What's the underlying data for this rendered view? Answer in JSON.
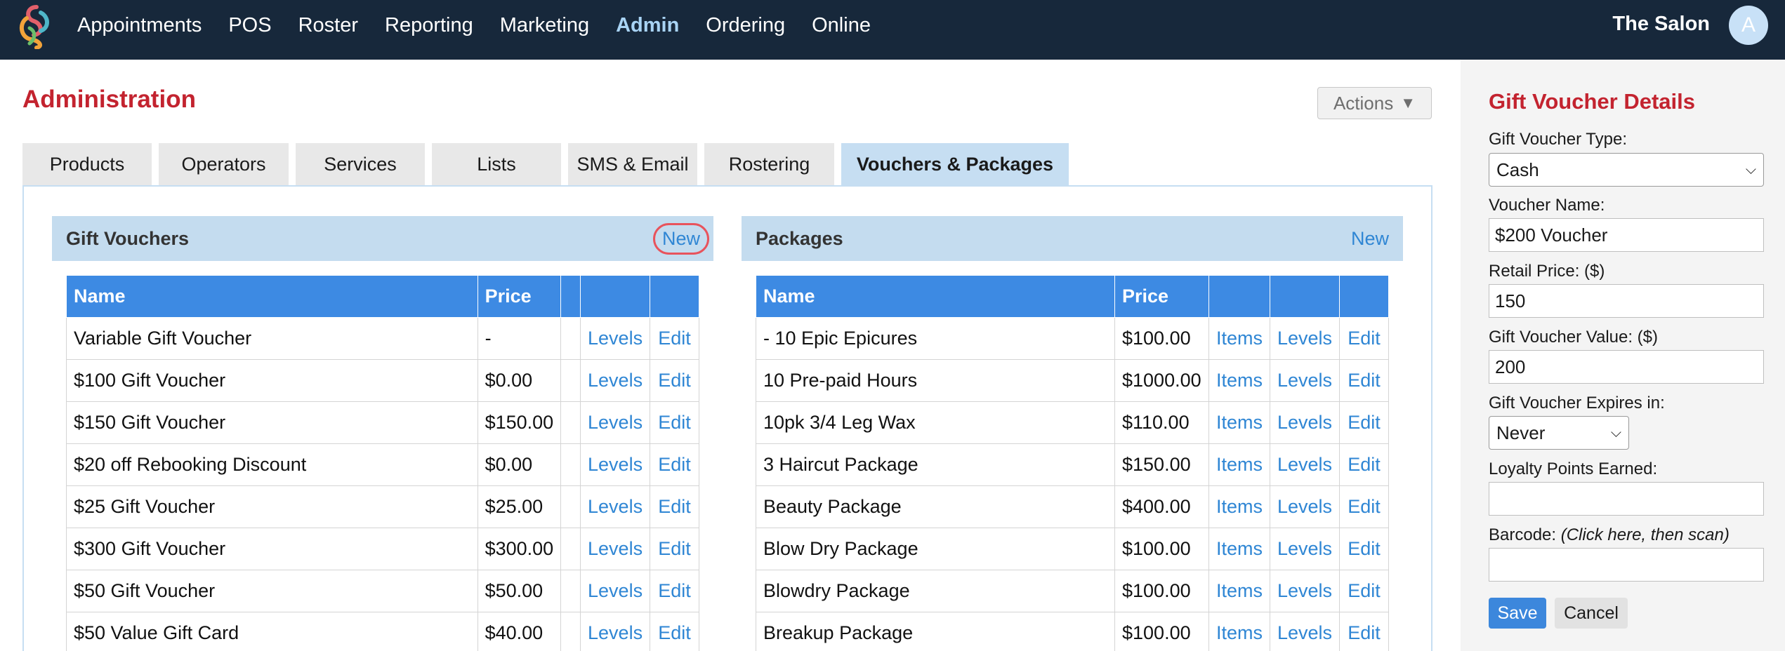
{
  "nav": {
    "items": [
      "Appointments",
      "POS",
      "Roster",
      "Reporting",
      "Marketing",
      "Admin",
      "Ordering",
      "Online"
    ],
    "active": "Admin",
    "salon_name": "The Salon",
    "avatar_initial": "A"
  },
  "page": {
    "title": "Administration",
    "actions_label": "Actions"
  },
  "tabs": [
    {
      "label": "Products"
    },
    {
      "label": "Operators"
    },
    {
      "label": "Services"
    },
    {
      "label": "Lists"
    },
    {
      "label": "SMS & Email"
    },
    {
      "label": "Rostering"
    },
    {
      "label": "Vouchers & Packages",
      "active": true
    }
  ],
  "gift_vouchers": {
    "title": "Gift Vouchers",
    "new_label": "New",
    "columns": [
      "Name",
      "Price",
      "",
      "",
      ""
    ],
    "levels_label": "Levels",
    "edit_label": "Edit",
    "rows": [
      {
        "name": "Variable Gift Voucher",
        "price": "-"
      },
      {
        "name": "$100 Gift Voucher",
        "price": "$0.00"
      },
      {
        "name": "$150 Gift Voucher",
        "price": "$150.00"
      },
      {
        "name": "$20 off Rebooking Discount",
        "price": "$0.00"
      },
      {
        "name": "$25 Gift Voucher",
        "price": "$25.00"
      },
      {
        "name": "$300 Gift Voucher",
        "price": "$300.00"
      },
      {
        "name": "$50 Gift Voucher",
        "price": "$50.00"
      },
      {
        "name": "$50 Value Gift Card",
        "price": "$40.00"
      }
    ]
  },
  "packages": {
    "title": "Packages",
    "new_label": "New",
    "columns": [
      "Name",
      "Price",
      "",
      "",
      ""
    ],
    "items_label": "Items",
    "levels_label": "Levels",
    "edit_label": "Edit",
    "rows": [
      {
        "name": "- 10 Epic Epicures",
        "price": "$100.00"
      },
      {
        "name": "10 Pre-paid Hours",
        "price": "$1000.00"
      },
      {
        "name": "10pk 3/4 Leg Wax",
        "price": "$110.00"
      },
      {
        "name": "3 Haircut Package",
        "price": "$150.00"
      },
      {
        "name": "Beauty Package",
        "price": "$400.00"
      },
      {
        "name": "Blow Dry Package",
        "price": "$100.00"
      },
      {
        "name": "Blowdry Package",
        "price": "$100.00"
      },
      {
        "name": "Breakup Package",
        "price": "$100.00"
      }
    ]
  },
  "details": {
    "title": "Gift Voucher Details",
    "type_label": "Gift Voucher Type:",
    "type_value": "Cash",
    "name_label": "Voucher Name:",
    "name_value": "$200 Voucher",
    "retail_label": "Retail Price: ($)",
    "retail_value": "150",
    "value_label": "Gift Voucher Value: ($)",
    "value_value": "200",
    "expires_label": "Gift Voucher Expires in:",
    "expires_value": "Never",
    "loyalty_label": "Loyalty Points Earned:",
    "loyalty_value": "",
    "barcode_label": "Barcode:",
    "barcode_hint": "(Click here, then scan)",
    "barcode_value": "",
    "save_label": "Save",
    "cancel_label": "Cancel"
  },
  "colors": {
    "topbar": "#17283b",
    "accent_red": "#c3232f",
    "link_blue": "#2f86d4",
    "table_header": "#3d8ae3",
    "section_header": "#c4dcef"
  }
}
